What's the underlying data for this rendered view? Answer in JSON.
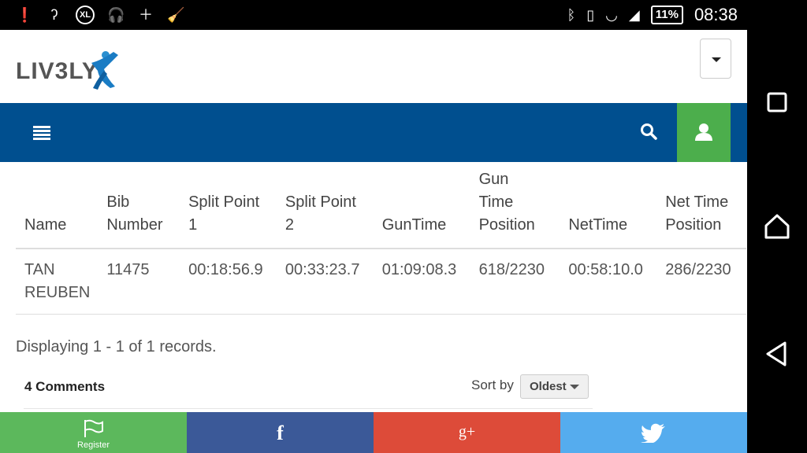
{
  "status_bar": {
    "battery": "11%",
    "time": "08:38"
  },
  "header": {
    "logo_text": "LIV3LY"
  },
  "table": {
    "headers": [
      [
        "Name"
      ],
      [
        "Bib",
        "Number"
      ],
      [
        "Split Point",
        "1"
      ],
      [
        "Split Point",
        "2"
      ],
      [
        "GunTime"
      ],
      [
        "Gun",
        "Time",
        "Position"
      ],
      [
        "NetTime"
      ],
      [
        "Net Time",
        "Position"
      ]
    ],
    "rows": [
      [
        [
          "TAN",
          "REUBEN"
        ],
        [
          "11475"
        ],
        [
          "00:18:56.9"
        ],
        [
          "00:33:23.7"
        ],
        [
          "01:09:08.3"
        ],
        [
          "618/2230"
        ],
        [
          "00:58:10.0"
        ],
        [
          "286/2230"
        ]
      ]
    ]
  },
  "records_text": "Displaying 1 - 1 of 1 records.",
  "comments": {
    "count_label": "4 Comments",
    "sort_label": "Sort by",
    "sort_value": "Oldest"
  },
  "share_bar": {
    "register_label": "Register"
  }
}
